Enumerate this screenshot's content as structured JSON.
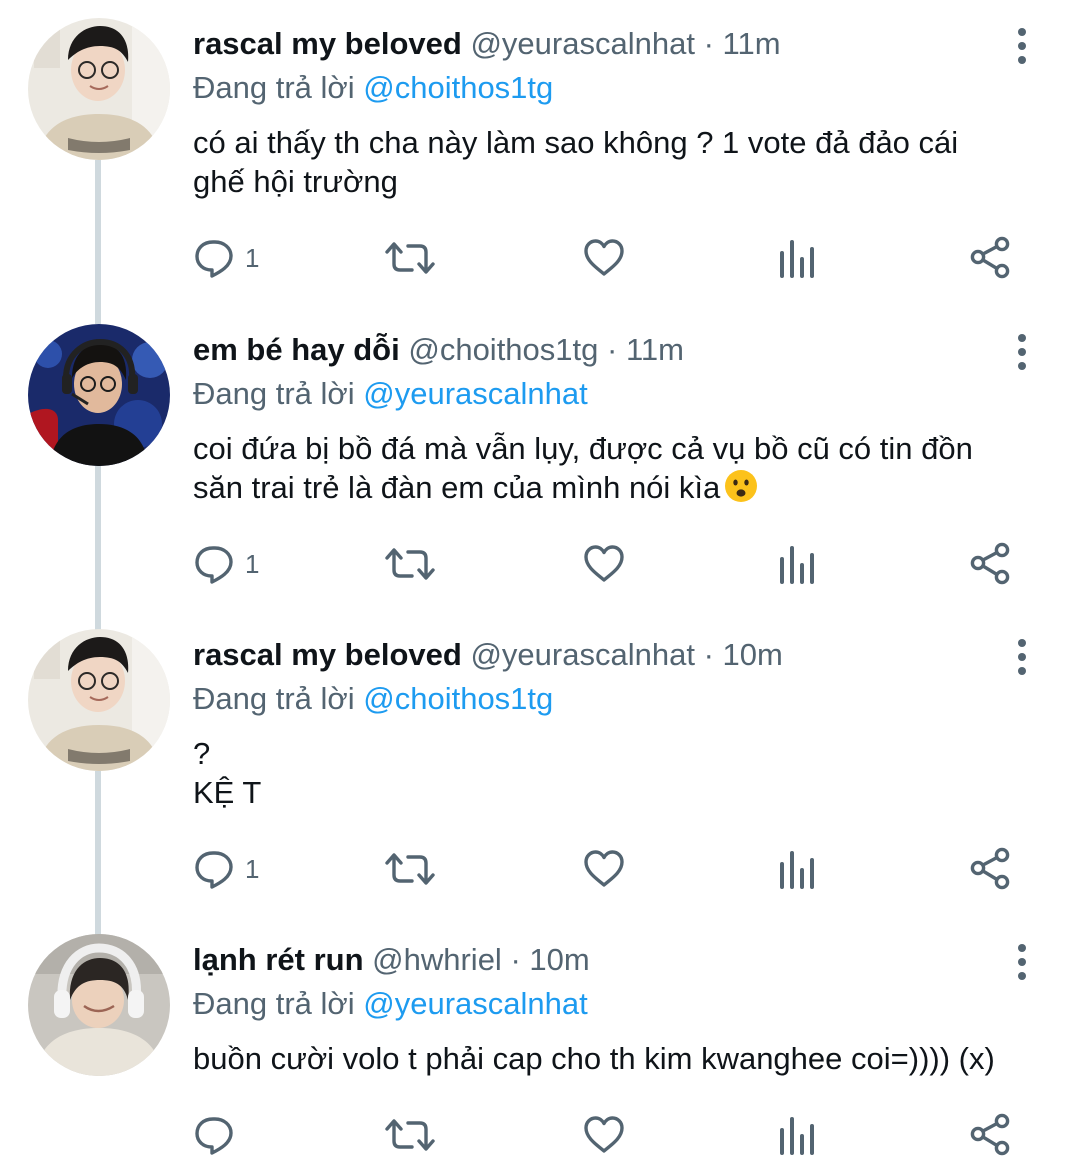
{
  "tweets": [
    {
      "name": "rascal my beloved",
      "handle": "@yeurascalnhat",
      "dot": "·",
      "time": "11m",
      "reply_prefix": "Đang trả lời",
      "reply_to": "@choithos1tg",
      "lines": [
        "có ai thấy th cha này làm sao không ? 1 vote đả đảo cái",
        "ghế hội trường"
      ],
      "reply_count": "1"
    },
    {
      "name": "em bé hay dỗi",
      "handle": "@choithos1tg",
      "dot": "·",
      "time": "11m",
      "reply_prefix": "Đang trả lời",
      "reply_to": "@yeurascalnhat",
      "lines": [
        "coi đứa bị bồ đá mà vẫn lụy, được cả vụ bồ cũ có tin đồn",
        "săn trai trẻ là đàn em của mình nói kìa"
      ],
      "emoji": "frowning-face-emoji",
      "reply_count": "1"
    },
    {
      "name": "rascal my beloved",
      "handle": "@yeurascalnhat",
      "dot": "·",
      "time": "10m",
      "reply_prefix": "Đang trả lời",
      "reply_to": "@choithos1tg",
      "lines": [
        "?",
        "KỆ T"
      ],
      "reply_count": "1"
    },
    {
      "name": "lạnh rét run",
      "handle": "@hwhriel",
      "dot": "·",
      "time": "10m",
      "reply_prefix": "Đang trả lời",
      "reply_to": "@yeurascalnhat",
      "lines": [
        "buồn cười volo t phải cap cho th kim kwanghee coi=)))) (x)"
      ],
      "reply_count": ""
    }
  ],
  "icons": {
    "reply": "reply-icon",
    "retweet": "retweet-icon",
    "like": "heart-icon",
    "analytics": "analytics-icon",
    "share": "share-icon",
    "more": "more-vertical-icon"
  },
  "colors": {
    "text": "#0f1419",
    "secondary": "#536471",
    "mention": "#1d9bf0",
    "thread_line": "#cfd9de"
  }
}
